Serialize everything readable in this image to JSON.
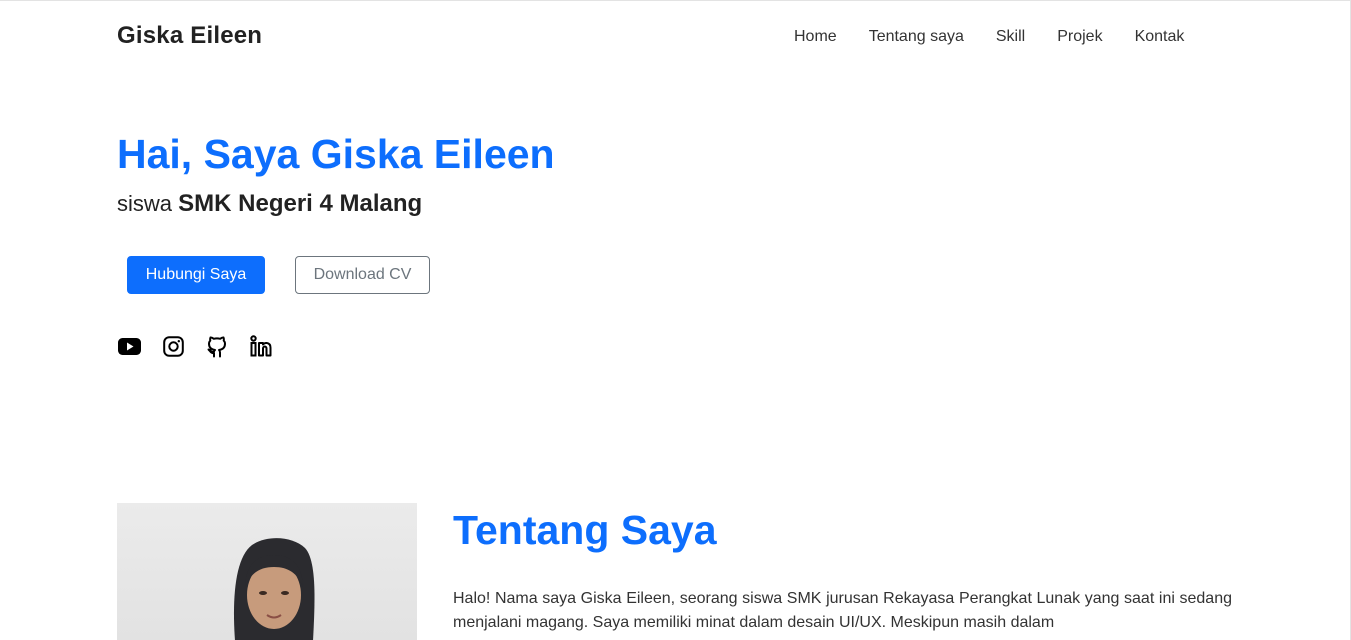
{
  "navbar": {
    "brand": "Giska Eileen",
    "links": [
      "Home",
      "Tentang saya",
      "Skill",
      "Projek",
      "Kontak"
    ]
  },
  "hero": {
    "title": "Hai, Saya Giska Eileen",
    "subtitle_prefix": "siswa",
    "subtitle_school": "SMK Negeri 4 Malang",
    "primary_button": "Hubungi Saya",
    "secondary_button": "Download CV",
    "social_icons": [
      "youtube-icon",
      "instagram-icon",
      "github-icon",
      "linkedin-icon"
    ]
  },
  "about": {
    "title": "Tentang Saya",
    "text": "Halo! Nama saya Giska Eileen, seorang siswa SMK jurusan Rekayasa Perangkat Lunak yang saat ini sedang menjalani magang. Saya memiliki minat dalam desain UI/UX. Meskipun masih dalam"
  },
  "colors": {
    "accent": "#0d6efd",
    "text": "#212529",
    "muted": "#6c757d"
  }
}
